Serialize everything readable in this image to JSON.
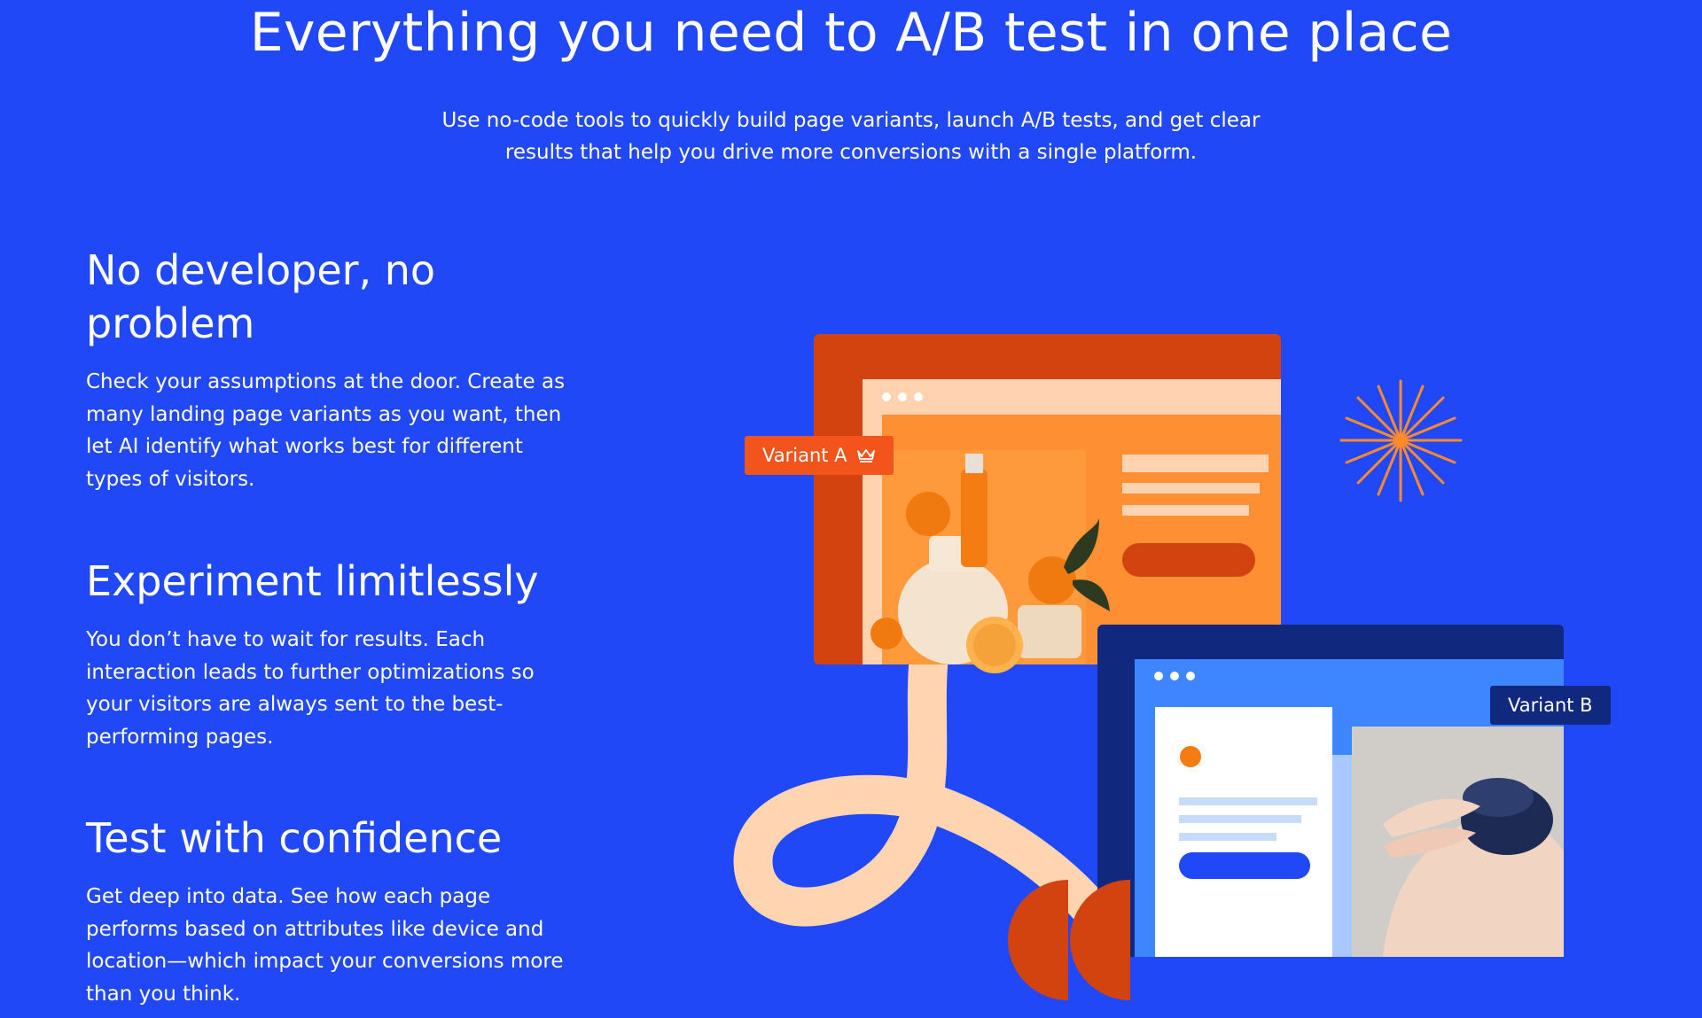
{
  "hero": {
    "title": "Everything you need to A/B test in one place",
    "subtitle_line1": "Use no-code tools to quickly build page variants, launch A/B tests, and get clear",
    "subtitle_line2": "results that help you drive more conversions with a single platform."
  },
  "features": [
    {
      "title": "No developer, no problem",
      "body": "Check your assumptions at the door. Create as many landing page variants as you want, then let AI identify what works best for different types of visitors."
    },
    {
      "title": "Experiment limitlessly",
      "body": "You don’t have to wait for results. Each interaction leads to further optimizations so your visitors are always sent to the best-performing pages."
    },
    {
      "title": "Test with confidence",
      "body": "Get deep into data. See how each page performs based on attributes like device and location—which impact your conversions more than you think."
    }
  ],
  "illustration": {
    "variant_a_label": "Variant A",
    "variant_b_label": "Variant B",
    "variant_a_icon": "crown-icon",
    "colors": {
      "background": "#2148F6",
      "variant_a_frame": "#D3430F",
      "variant_a_page": "#FF8F33",
      "variant_a_browserbar": "#FFD3B0",
      "variant_a_tag": "#F2541B",
      "variant_b_frame": "#10287E",
      "variant_b_page": "#3E86FF",
      "variant_b_tag": "#10287E",
      "loop": "#FFD4B0",
      "sparkle": "#FF8A2C"
    }
  }
}
